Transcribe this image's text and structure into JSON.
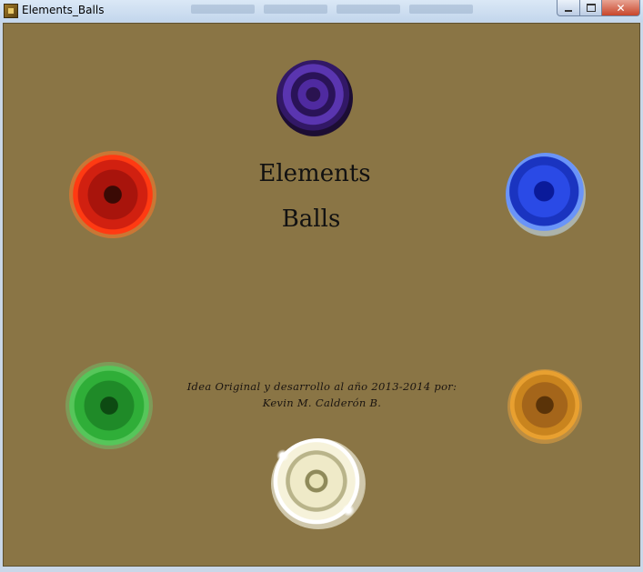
{
  "window": {
    "title": "Elements_Balls",
    "controls": {
      "minimize": "minimize",
      "maximize": "maximize",
      "close": "close"
    }
  },
  "game": {
    "background_color": "#8a7545",
    "title_line1": "Elements",
    "title_line2": "Balls",
    "credits_line1": "Idea Original y desarrollo al año 2013-2014 por:",
    "credits_line2": "Kevin M. Calderón B.",
    "orbs": [
      {
        "element": "dark",
        "color": "#4f2aa0"
      },
      {
        "element": "fire",
        "color": "#d12010"
      },
      {
        "element": "water",
        "color": "#2a4ae6"
      },
      {
        "element": "leaf",
        "color": "#2fae38"
      },
      {
        "element": "rock",
        "color": "#c9841e"
      },
      {
        "element": "light",
        "color": "#efeac8"
      }
    ]
  }
}
